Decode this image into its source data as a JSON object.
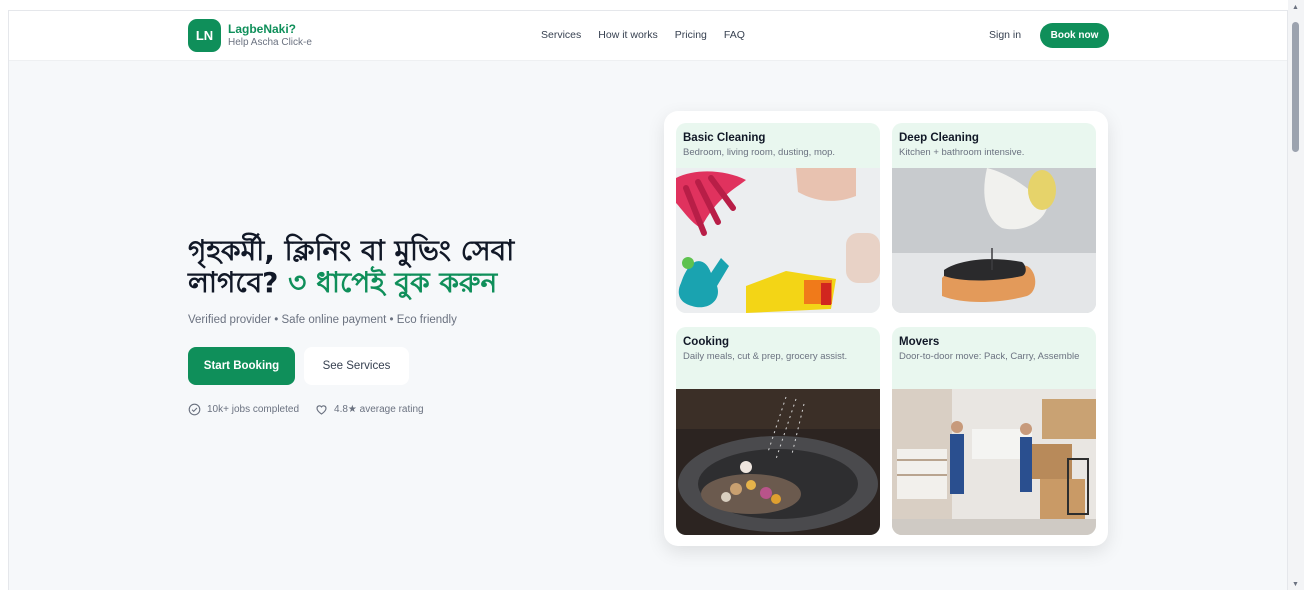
{
  "header": {
    "logo_initials": "LN",
    "brand_name": "LagbeNaki?",
    "brand_tagline": "Help Ascha Click-e",
    "nav": [
      "Services",
      "How it works",
      "Pricing",
      "FAQ"
    ],
    "sign_in": "Sign in",
    "book_now": "Book now"
  },
  "hero": {
    "title_line1": "গৃহকর্মী, ক্লিনিং বা মুভিং সেবা",
    "title_line2_plain": "লাগবে? ",
    "title_line2_accent": "৩ ধাপেই বুক করুন",
    "subtitle": "Verified provider • Safe online payment • Eco friendly",
    "start_booking": "Start Booking",
    "see_services": "See Services",
    "stats": [
      {
        "text": "10k+ jobs completed",
        "icon": "check-circle-icon"
      },
      {
        "text": "4.8★ average rating",
        "icon": "heart-icon"
      }
    ]
  },
  "services": [
    {
      "title": "Basic Cleaning",
      "desc": "Bedroom, living room, dusting, mop."
    },
    {
      "title": "Deep Cleaning",
      "desc": "Kitchen + bathroom intensive."
    },
    {
      "title": "Cooking",
      "desc": "Daily meals, cut & prep, grocery assist."
    },
    {
      "title": "Movers",
      "desc": "Door-to-door move: Pack, Carry, Assemble"
    }
  ],
  "colors": {
    "brand": "#0f8f5a",
    "tile_bg": "#e9f7ef"
  }
}
